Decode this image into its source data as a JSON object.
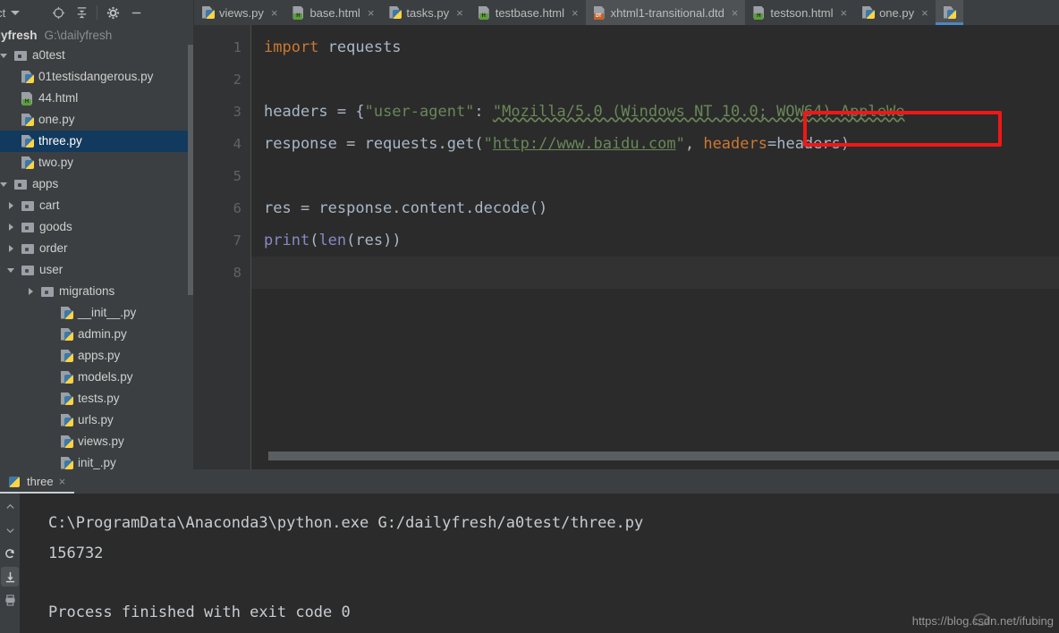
{
  "toolbar": {
    "project_label": "ject",
    "icons": [
      {
        "name": "locate-icon",
        "glyph": "⊕"
      },
      {
        "name": "collapse-all-icon",
        "glyph": "⩡"
      },
      {
        "name": "settings-gear-icon",
        "glyph": "⚙"
      },
      {
        "name": "minimize-icon",
        "glyph": "—"
      }
    ]
  },
  "tabs": [
    {
      "label": "views.py",
      "icon": "python-file-icon",
      "type": "py",
      "active": false,
      "close": "×"
    },
    {
      "label": "base.html",
      "icon": "html-file-icon",
      "type": "html",
      "active": false,
      "close": "×"
    },
    {
      "label": "tasks.py",
      "icon": "python-file-icon",
      "type": "py",
      "active": false,
      "close": "×"
    },
    {
      "label": "testbase.html",
      "icon": "html-file-icon",
      "type": "html",
      "active": false,
      "close": "×"
    },
    {
      "label": "xhtml1-transitional.dtd",
      "icon": "dtd-file-icon",
      "type": "dtd",
      "active": true,
      "close": "×"
    },
    {
      "label": "testson.html",
      "icon": "html-file-icon",
      "type": "html",
      "active": false,
      "close": "×"
    },
    {
      "label": "one.py",
      "icon": "python-file-icon",
      "type": "py",
      "active": false,
      "close": "×"
    }
  ],
  "project": {
    "name": "ailyfresh",
    "path": "G:\\dailyfresh",
    "tree": [
      {
        "label": "a0test",
        "indent": 0,
        "icon": "folder-open-icon",
        "twisty": "open",
        "selected": false
      },
      {
        "label": "01testisdangerous.py",
        "indent": 1,
        "icon": "python-file-icon",
        "twisty": "none",
        "selected": false
      },
      {
        "label": "44.html",
        "indent": 1,
        "icon": "html-file-icon",
        "twisty": "none",
        "selected": false
      },
      {
        "label": "one.py",
        "indent": 1,
        "icon": "python-file-icon",
        "twisty": "none",
        "selected": false
      },
      {
        "label": "three.py",
        "indent": 1,
        "icon": "python-file-icon",
        "twisty": "none",
        "selected": true
      },
      {
        "label": "two.py",
        "indent": 1,
        "icon": "python-file-icon",
        "twisty": "none",
        "selected": false
      },
      {
        "label": "apps",
        "indent": 0,
        "icon": "folder-open-icon",
        "twisty": "open",
        "selected": false
      },
      {
        "label": "cart",
        "indent": 1,
        "icon": "folder-icon",
        "twisty": "closed",
        "selected": false
      },
      {
        "label": "goods",
        "indent": 1,
        "icon": "folder-icon",
        "twisty": "closed",
        "selected": false
      },
      {
        "label": "order",
        "indent": 1,
        "icon": "folder-icon",
        "twisty": "closed",
        "selected": false
      },
      {
        "label": "user",
        "indent": 1,
        "icon": "folder-icon",
        "twisty": "open",
        "selected": false
      },
      {
        "label": "migrations",
        "indent": 2,
        "icon": "folder-icon",
        "twisty": "closed",
        "selected": false
      },
      {
        "label": "__init__.py",
        "indent": 3,
        "icon": "python-file-icon",
        "twisty": "none",
        "selected": false
      },
      {
        "label": "admin.py",
        "indent": 3,
        "icon": "python-file-icon",
        "twisty": "none",
        "selected": false
      },
      {
        "label": "apps.py",
        "indent": 3,
        "icon": "python-file-icon",
        "twisty": "none",
        "selected": false
      },
      {
        "label": "models.py",
        "indent": 3,
        "icon": "python-file-icon",
        "twisty": "none",
        "selected": false
      },
      {
        "label": "tests.py",
        "indent": 3,
        "icon": "python-file-icon",
        "twisty": "none",
        "selected": false
      },
      {
        "label": "urls.py",
        "indent": 3,
        "icon": "python-file-icon",
        "twisty": "none",
        "selected": false
      },
      {
        "label": "views.py",
        "indent": 3,
        "icon": "python-file-icon",
        "twisty": "none",
        "selected": false
      },
      {
        "label": "init_.py",
        "indent": 3,
        "icon": "python-file-icon",
        "twisty": "none",
        "selected": false
      }
    ]
  },
  "editor": {
    "line_numbers": [
      "1",
      "2",
      "3",
      "4",
      "5",
      "6",
      "7",
      "8"
    ],
    "current_line": 8,
    "lines": [
      {
        "n": 1,
        "segments": [
          {
            "t": "import ",
            "c": "kw"
          },
          {
            "t": "requests",
            "c": "plain"
          }
        ]
      },
      {
        "n": 2,
        "segments": []
      },
      {
        "n": 3,
        "segments": [
          {
            "t": "headers = {",
            "c": "plain"
          },
          {
            "t": "\"user-agent\"",
            "c": "str"
          },
          {
            "t": ": ",
            "c": "plain"
          },
          {
            "t": "\"Mozilla/5.0 (Windows NT 10.0; WOW64) AppleWe",
            "c": "squiggle-str"
          }
        ]
      },
      {
        "n": 4,
        "segments": [
          {
            "t": "response = requests.get(",
            "c": "plain"
          },
          {
            "t": "\"",
            "c": "str"
          },
          {
            "t": "http://www.baidu.com",
            "c": "url"
          },
          {
            "t": "\"",
            "c": "str"
          },
          {
            "t": ", ",
            "c": "plain"
          },
          {
            "t": "headers",
            "c": "kw"
          },
          {
            "t": "=headers)",
            "c": "plain"
          }
        ]
      },
      {
        "n": 5,
        "segments": []
      },
      {
        "n": 6,
        "segments": [
          {
            "t": "res = response.content.decode()",
            "c": "plain"
          }
        ]
      },
      {
        "n": 7,
        "segments": [
          {
            "t": "print",
            "c": "builtin"
          },
          {
            "t": "(",
            "c": "plain"
          },
          {
            "t": "len",
            "c": "builtin"
          },
          {
            "t": "(res))",
            "c": "plain"
          }
        ]
      },
      {
        "n": 8,
        "segments": []
      }
    ],
    "highlight_box": {
      "label": "headers=headers)",
      "color": "#f11717"
    }
  },
  "console": {
    "tab_label": "three",
    "tab_close": "×",
    "lines": [
      "C:\\ProgramData\\Anaconda3\\python.exe G:/dailyfresh/a0test/three.py",
      "156732",
      "",
      "Process finished with exit code 0"
    ],
    "sidebar_icons": [
      {
        "name": "chevron-up-icon",
        "glyph": "⌃"
      },
      {
        "name": "chevron-down-icon",
        "glyph": "⌄"
      },
      {
        "name": "rerun-icon",
        "glyph": "↺"
      },
      {
        "name": "scroll-to-end-icon",
        "glyph": "⤓"
      },
      {
        "name": "print-icon",
        "glyph": "⎙"
      }
    ]
  },
  "watermark": {
    "text": "https://blog.csdn.net/ifubing"
  },
  "colors": {
    "panel_bg": "#3c3f41",
    "editor_bg": "#2b2b2b",
    "gutter_bg": "#313335",
    "selection_blue": "#123a5e",
    "accent_blue": "#4a88c7",
    "keyword_orange": "#cc7832",
    "string_green": "#6a8759",
    "builtin_purple": "#8888c6",
    "default_text": "#a9b7c6",
    "highlight_red": "#f11717"
  }
}
